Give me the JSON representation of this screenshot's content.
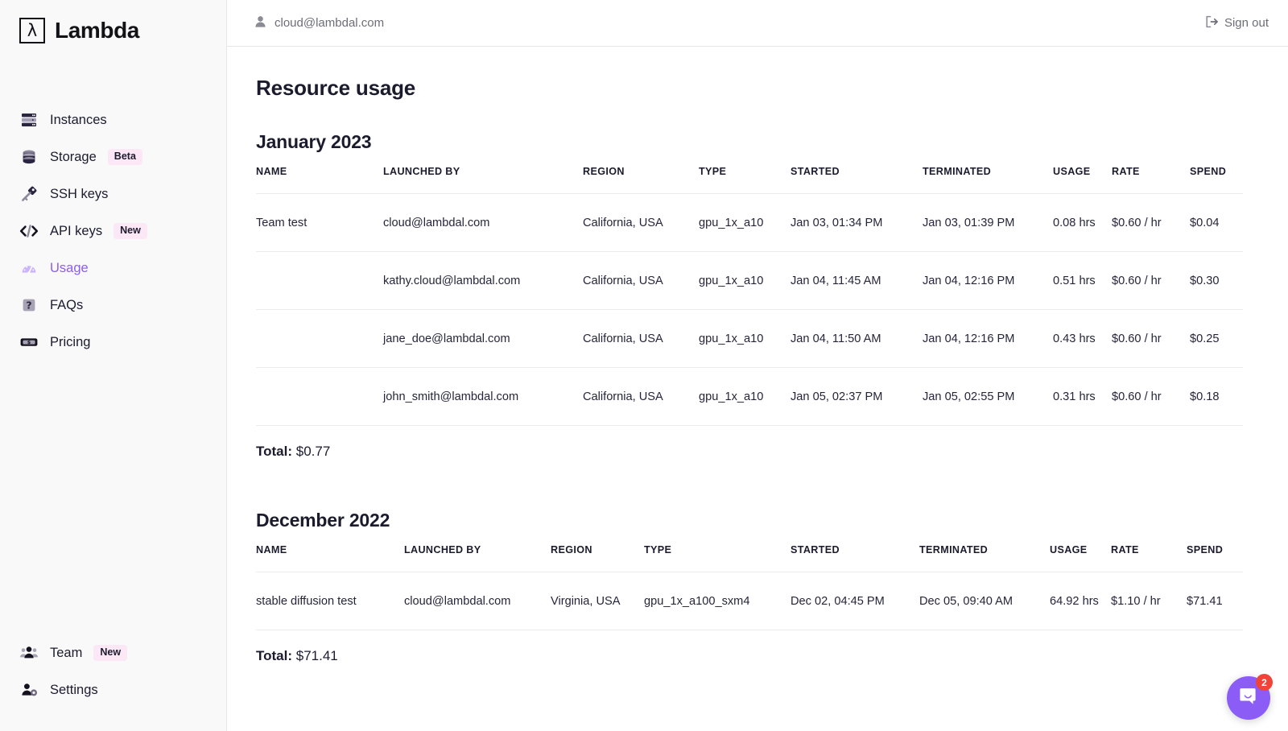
{
  "brand": {
    "mark": "λ",
    "name": "Lambda"
  },
  "topbar": {
    "account_email": "cloud@lambdal.com",
    "signout_label": "Sign out"
  },
  "sidebar": {
    "items": [
      {
        "label": "Instances",
        "icon": "server-rack-icon",
        "badge": null,
        "active": false
      },
      {
        "label": "Storage",
        "icon": "database-icon",
        "badge": "Beta",
        "active": false
      },
      {
        "label": "SSH keys",
        "icon": "key-icon",
        "badge": null,
        "active": false
      },
      {
        "label": "API keys",
        "icon": "code-brackets-icon",
        "badge": "New",
        "active": false
      },
      {
        "label": "Usage",
        "icon": "gauge-icon",
        "badge": null,
        "active": true
      },
      {
        "label": "FAQs",
        "icon": "question-mark-icon",
        "badge": null,
        "active": false
      },
      {
        "label": "Pricing",
        "icon": "banknote-icon",
        "badge": null,
        "active": false
      }
    ],
    "bottom_items": [
      {
        "label": "Team",
        "icon": "people-icon",
        "badge": "New"
      },
      {
        "label": "Settings",
        "icon": "user-gear-icon",
        "badge": null
      }
    ]
  },
  "main": {
    "page_title": "Resource usage",
    "columns": [
      "NAME",
      "LAUNCHED BY",
      "REGION",
      "TYPE",
      "STARTED",
      "TERMINATED",
      "USAGE",
      "RATE",
      "SPEND"
    ],
    "sections": [
      {
        "month": "January 2023",
        "rows": [
          {
            "name": "Team test",
            "launched_by": "cloud@lambdal.com",
            "region": "California, USA",
            "type": "gpu_1x_a10",
            "started": "Jan 03, 01:34 PM",
            "terminated": "Jan 03, 01:39 PM",
            "usage": "0.08 hrs",
            "rate": "$0.60 / hr",
            "spend": "$0.04"
          },
          {
            "name": "",
            "launched_by": "kathy.cloud@lambdal.com",
            "region": "California, USA",
            "type": "gpu_1x_a10",
            "started": "Jan 04, 11:45 AM",
            "terminated": "Jan 04, 12:16 PM",
            "usage": "0.51 hrs",
            "rate": "$0.60 / hr",
            "spend": "$0.30"
          },
          {
            "name": "",
            "launched_by": "jane_doe@lambdal.com",
            "region": "California, USA",
            "type": "gpu_1x_a10",
            "started": "Jan 04, 11:50 AM",
            "terminated": "Jan 04, 12:16 PM",
            "usage": "0.43 hrs",
            "rate": "$0.60 / hr",
            "spend": "$0.25"
          },
          {
            "name": "",
            "launched_by": "john_smith@lambdal.com",
            "region": "California, USA",
            "type": "gpu_1x_a10",
            "started": "Jan 05, 02:37 PM",
            "terminated": "Jan 05, 02:55 PM",
            "usage": "0.31 hrs",
            "rate": "$0.60 / hr",
            "spend": "$0.18"
          }
        ],
        "total_label": "Total:",
        "total_value": "$0.77"
      },
      {
        "month": "December 2022",
        "rows": [
          {
            "name": "stable diffusion test",
            "launched_by": "cloud@lambdal.com",
            "region": "Virginia, USA",
            "type": "gpu_1x_a100_sxm4",
            "started": "Dec 02, 04:45 PM",
            "terminated": "Dec 05, 09:40 AM",
            "usage": "64.92 hrs",
            "rate": "$1.10 / hr",
            "spend": "$71.41"
          }
        ],
        "total_label": "Total:",
        "total_value": "$71.41"
      }
    ]
  },
  "chat": {
    "unread_count": "2",
    "icon": "chat-bubble-icon"
  },
  "colors": {
    "accent_purple": "#8b5cf6",
    "badge_pink_bg": "#fce7f6",
    "badge_pink_text": "#e217b",
    "chat_badge_red": "#f04438",
    "sidebar_bg": "#f9f9fa",
    "text_primary": "#1c1b2e",
    "text_muted": "#6d6d78"
  }
}
